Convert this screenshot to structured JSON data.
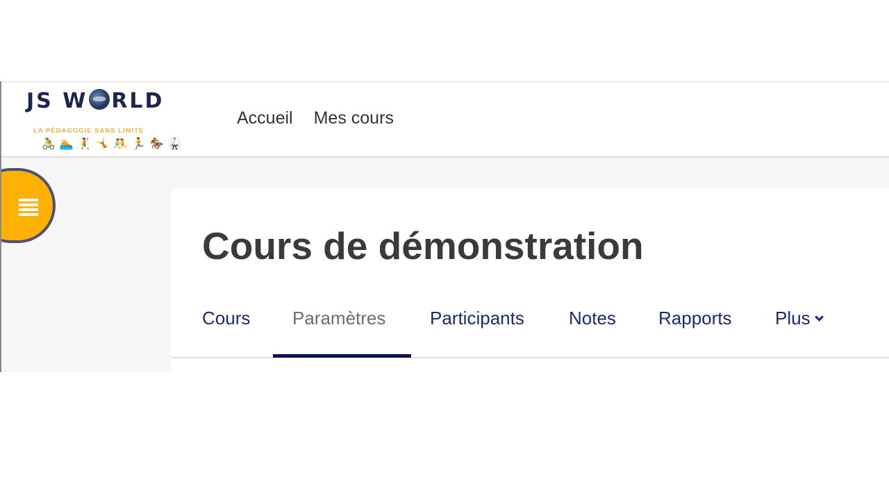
{
  "header": {
    "logo": {
      "title_left": "JS W",
      "title_right": "RLD",
      "tagline": "LA PÉDAGOGIE SANS LIMITE",
      "sports_icons": [
        "🚴",
        "🏊",
        "🤾",
        "🤸",
        "🤼",
        "🏃",
        "🏇",
        "🥋"
      ]
    },
    "nav": [
      {
        "label": "Accueil"
      },
      {
        "label": "Mes cours"
      }
    ]
  },
  "course": {
    "title": "Cours de démonstration",
    "tabs": [
      {
        "label": "Cours"
      },
      {
        "label": "Paramètres",
        "active": true
      },
      {
        "label": "Participants"
      },
      {
        "label": "Notes"
      },
      {
        "label": "Rapports"
      },
      {
        "label": "Plus"
      }
    ]
  },
  "colors": {
    "accent_yellow": "#fdb100",
    "tab_text": "#1d2a6b",
    "active_underline": "#0b0b5c"
  },
  "icons": {
    "drawer_toggle": "list-icon",
    "more_chevron": "chevron-down-icon"
  }
}
